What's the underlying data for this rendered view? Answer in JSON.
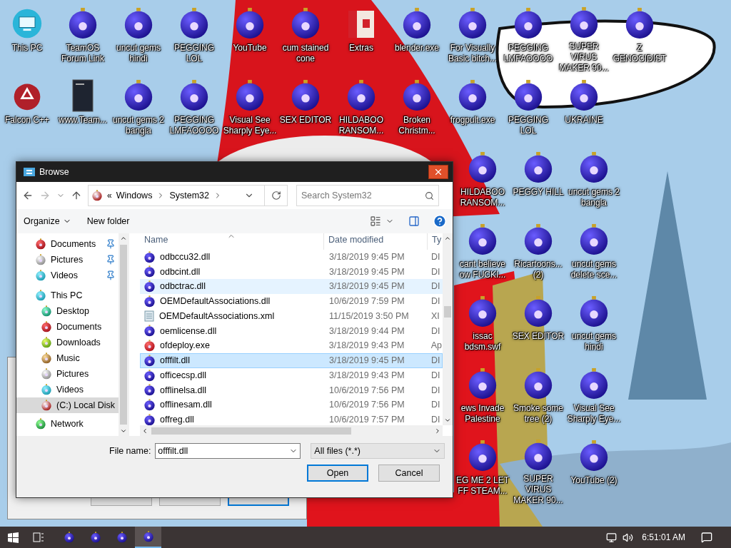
{
  "desktop_icons_top": [
    {
      "label": "This PC",
      "kind": "pc"
    },
    {
      "label": "TeamOS Forum Link",
      "kind": "ornament"
    },
    {
      "label": "uncut gems hindi",
      "kind": "ornament"
    },
    {
      "label": "PEGGING LOL",
      "kind": "ornament"
    },
    {
      "label": "YouTube",
      "kind": "ornament"
    },
    {
      "label": "cum stained cone",
      "kind": "ornament"
    },
    {
      "label": "Extras",
      "kind": "gift"
    },
    {
      "label": "blender.exe",
      "kind": "ornament"
    },
    {
      "label": "For Visually Basic bitch...",
      "kind": "ornament"
    },
    {
      "label": "PEGGING LMFAOOOO",
      "kind": "ornament"
    },
    {
      "label": "SUPER VIRUS MAKER 90...",
      "kind": "ornament"
    },
    {
      "label": "Z GENOCIDIST",
      "kind": "ornament"
    },
    {
      "label": "Falcon C++",
      "kind": "recycle"
    },
    {
      "label": "www.Team...",
      "kind": "book"
    },
    {
      "label": "uncut gems 2 bangla",
      "kind": "ornament"
    },
    {
      "label": "PEGGING LMFAOOOO",
      "kind": "ornament"
    },
    {
      "label": "Visual See Sharply Eye...",
      "kind": "ornament"
    },
    {
      "label": "SEX EDITOR",
      "kind": "ornament"
    },
    {
      "label": "HILDABOO RANSOM...",
      "kind": "ornament"
    },
    {
      "label": "Broken Christm...",
      "kind": "ornament"
    },
    {
      "label": "frogpult.exe",
      "kind": "ornament"
    },
    {
      "label": "PEGGING LOL",
      "kind": "ornament"
    },
    {
      "label": "UKRAINE",
      "kind": "ornament"
    }
  ],
  "desktop_icons_right": [
    {
      "label": "HILDABOO RANSOM...",
      "kind": "ornament"
    },
    {
      "label": "PEGGY HILL",
      "kind": "ornament"
    },
    {
      "label": "uncut gems 2 bangla",
      "kind": "ornament"
    },
    {
      "label": "cant believe ow FUCKI...",
      "kind": "ornament"
    },
    {
      "label": "Ricartoons... (2)",
      "kind": "ornament"
    },
    {
      "label": "uncut gems delete sce...",
      "kind": "ornament"
    },
    {
      "label": "issac bdsm.swf",
      "kind": "ornament"
    },
    {
      "label": "SEX EDITOR",
      "kind": "ornament"
    },
    {
      "label": "uncut gems hindi",
      "kind": "ornament"
    },
    {
      "label": "ews Invade Palestine",
      "kind": "ornament"
    },
    {
      "label": "Smoke some tree (2)",
      "kind": "ornament"
    },
    {
      "label": "Visual See Sharply Eye...",
      "kind": "ornament"
    },
    {
      "label": "EG ME 2 LET FF STEAM...",
      "kind": "ornament"
    },
    {
      "label": "SUPER VIRUS MAKER 90...",
      "kind": "ornament"
    },
    {
      "label": "YouTube (2)",
      "kind": "ornament"
    }
  ],
  "dialog": {
    "title": "Browse",
    "address": {
      "overflow": "«",
      "path": [
        "Windows",
        "System32"
      ]
    },
    "search": {
      "placeholder": "Search System32"
    },
    "toolbar": {
      "organize": "Organize",
      "new_folder": "New folder"
    },
    "nav_tree": [
      {
        "label": "Documents",
        "kind": "documents",
        "pinned": true,
        "selected": false
      },
      {
        "label": "Pictures",
        "kind": "pictures",
        "pinned": true,
        "selected": false
      },
      {
        "label": "Videos",
        "kind": "videos",
        "pinned": true,
        "selected": false
      },
      {
        "label": "This PC",
        "kind": "pc",
        "pinned": false,
        "selected": false,
        "children": [
          {
            "label": "Desktop",
            "kind": "desktop",
            "pinned": false,
            "selected": false
          },
          {
            "label": "Documents",
            "kind": "documents",
            "pinned": false,
            "selected": false
          },
          {
            "label": "Downloads",
            "kind": "downloads",
            "pinned": false,
            "selected": false
          },
          {
            "label": "Music",
            "kind": "music",
            "pinned": false,
            "selected": false
          },
          {
            "label": "Pictures",
            "kind": "pictures",
            "pinned": false,
            "selected": false
          },
          {
            "label": "Videos",
            "kind": "videos",
            "pinned": false,
            "selected": false
          },
          {
            "label": "(C:) Local Disk",
            "kind": "disk",
            "pinned": false,
            "selected": true
          }
        ]
      },
      {
        "label": "Network",
        "kind": "network",
        "pinned": false,
        "selected": false
      }
    ],
    "columns": [
      "Name",
      "Date modified",
      "Ty"
    ],
    "files": [
      {
        "name": "odbccu32.dll",
        "date": "3/18/2019 9:45 PM",
        "type": "DI",
        "kind": "dll",
        "selected": false,
        "hovered": false
      },
      {
        "name": "odbcint.dll",
        "date": "3/18/2019 9:45 PM",
        "type": "DI",
        "kind": "dll",
        "selected": false,
        "hovered": false
      },
      {
        "name": "odbctrac.dll",
        "date": "3/18/2019 9:45 PM",
        "type": "DI",
        "kind": "dll",
        "selected": false,
        "hovered": true
      },
      {
        "name": "OEMDefaultAssociations.dll",
        "date": "10/6/2019 7:59 PM",
        "type": "DI",
        "kind": "dll",
        "selected": false,
        "hovered": false
      },
      {
        "name": "OEMDefaultAssociations.xml",
        "date": "11/15/2019 3:50 PM",
        "type": "XI",
        "kind": "xml",
        "selected": false,
        "hovered": false
      },
      {
        "name": "oemlicense.dll",
        "date": "3/18/2019 9:44 PM",
        "type": "DI",
        "kind": "dll",
        "selected": false,
        "hovered": false
      },
      {
        "name": "ofdeploy.exe",
        "date": "3/18/2019 9:43 PM",
        "type": "Ap",
        "kind": "exe",
        "selected": false,
        "hovered": false
      },
      {
        "name": "offfilt.dll",
        "date": "3/18/2019 9:45 PM",
        "type": "DI",
        "kind": "dll",
        "selected": true,
        "hovered": false
      },
      {
        "name": "officecsp.dll",
        "date": "3/18/2019 9:43 PM",
        "type": "DI",
        "kind": "dll",
        "selected": false,
        "hovered": false
      },
      {
        "name": "offlinelsa.dll",
        "date": "10/6/2019 7:56 PM",
        "type": "DI",
        "kind": "dll",
        "selected": false,
        "hovered": false
      },
      {
        "name": "offlinesam.dll",
        "date": "10/6/2019 7:56 PM",
        "type": "DI",
        "kind": "dll",
        "selected": false,
        "hovered": false
      },
      {
        "name": "offreg.dll",
        "date": "10/6/2019 7:57 PM",
        "type": "DI",
        "kind": "dll",
        "selected": false,
        "hovered": false
      }
    ],
    "file_name_label": "File name:",
    "file_name": "offfilt.dll",
    "filter": "All files (*.*)",
    "buttons": [
      "Open",
      "Cancel"
    ]
  },
  "taskbar": {
    "apps": [
      {
        "selected": false
      },
      {
        "selected": false
      },
      {
        "selected": false
      },
      {
        "selected": true
      }
    ],
    "time": "6:51:01 AM"
  }
}
